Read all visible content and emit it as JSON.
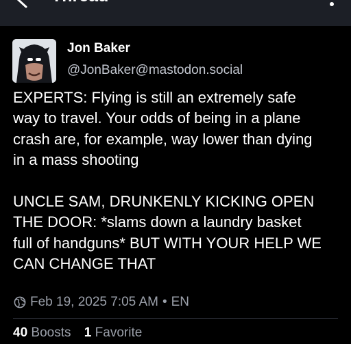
{
  "header": {
    "title": "Thread",
    "back_icon": "arrow-left-icon",
    "menu_icon": "more-vertical-icon"
  },
  "post": {
    "author": {
      "display_name": "Jon Baker",
      "handle": "@JonBaker@mastodon.social",
      "avatar_icon": "avatar-image"
    },
    "text": "EXPERTS: Flying is still an extremely safe\nway to travel. Your odds of being in a plane\ncrash are, for example, way lower than dying\nin a mass shooting\n\nUNCLE SAM, DRUNKENLY KICKING OPEN\nTHE DOOR: *slams down a laundry basket\nfull of handguns* BUT WITH YOUR HELP WE\nCAN CHANGE THAT",
    "visibility_icon": "globe-icon",
    "timestamp": "Feb 19, 2025 7:05 AM",
    "separator": "•",
    "language": "EN",
    "stats": {
      "boosts_count": "40",
      "boosts_label": "Boosts",
      "favorites_count": "1",
      "favorites_label": "Favorite"
    }
  },
  "colors": {
    "background": "#000000",
    "topbar": "#1c1f26",
    "text": "#ffffff",
    "secondary_text": "#9ba0aa"
  }
}
